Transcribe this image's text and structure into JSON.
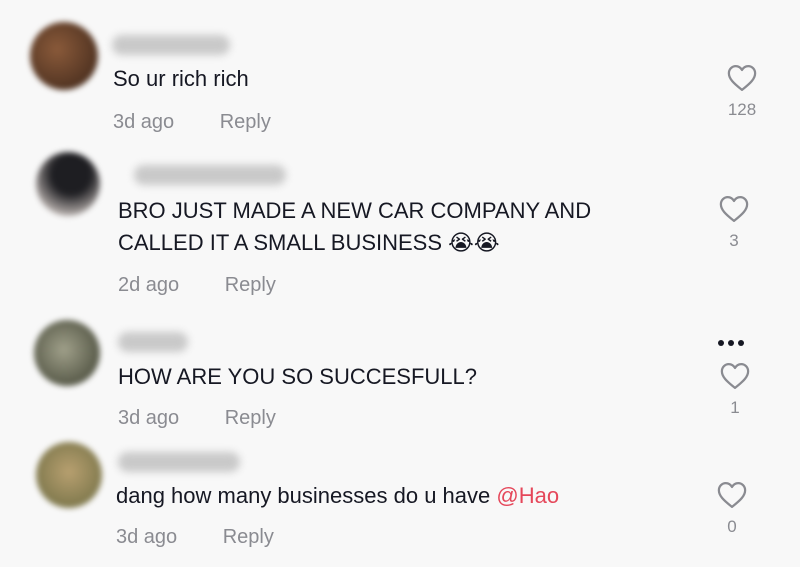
{
  "comments": [
    {
      "text": "So ur rich rich",
      "mention": "",
      "age": "3d ago",
      "reply_label": "Reply",
      "likes": "128",
      "avatar_color": "#5a3a2a"
    },
    {
      "text_line1": "BRO JUST MADE A NEW CAR COMPANY AND",
      "text_line2": "CALLED IT A SMALL BUSINESS 😭😭",
      "age": "2d ago",
      "reply_label": "Reply",
      "likes": "3",
      "avatar_color": "#3a3030"
    },
    {
      "text": "HOW ARE YOU SO SUCCESFULL?",
      "age": "3d ago",
      "reply_label": "Reply",
      "likes": "1",
      "avatar_color": "#4a5040"
    },
    {
      "text": "dang how many businesses do u have ",
      "mention": "@Hao",
      "age": "3d ago",
      "reply_label": "Reply",
      "likes": "0",
      "avatar_color": "#8a7a55"
    }
  ],
  "colors": {
    "background": "#f8f8f8",
    "text": "#161823",
    "muted": "#8a8b91",
    "mention": "#e5475a"
  },
  "icons": {
    "like": "heart-outline-icon",
    "more": "more-dots-icon"
  }
}
